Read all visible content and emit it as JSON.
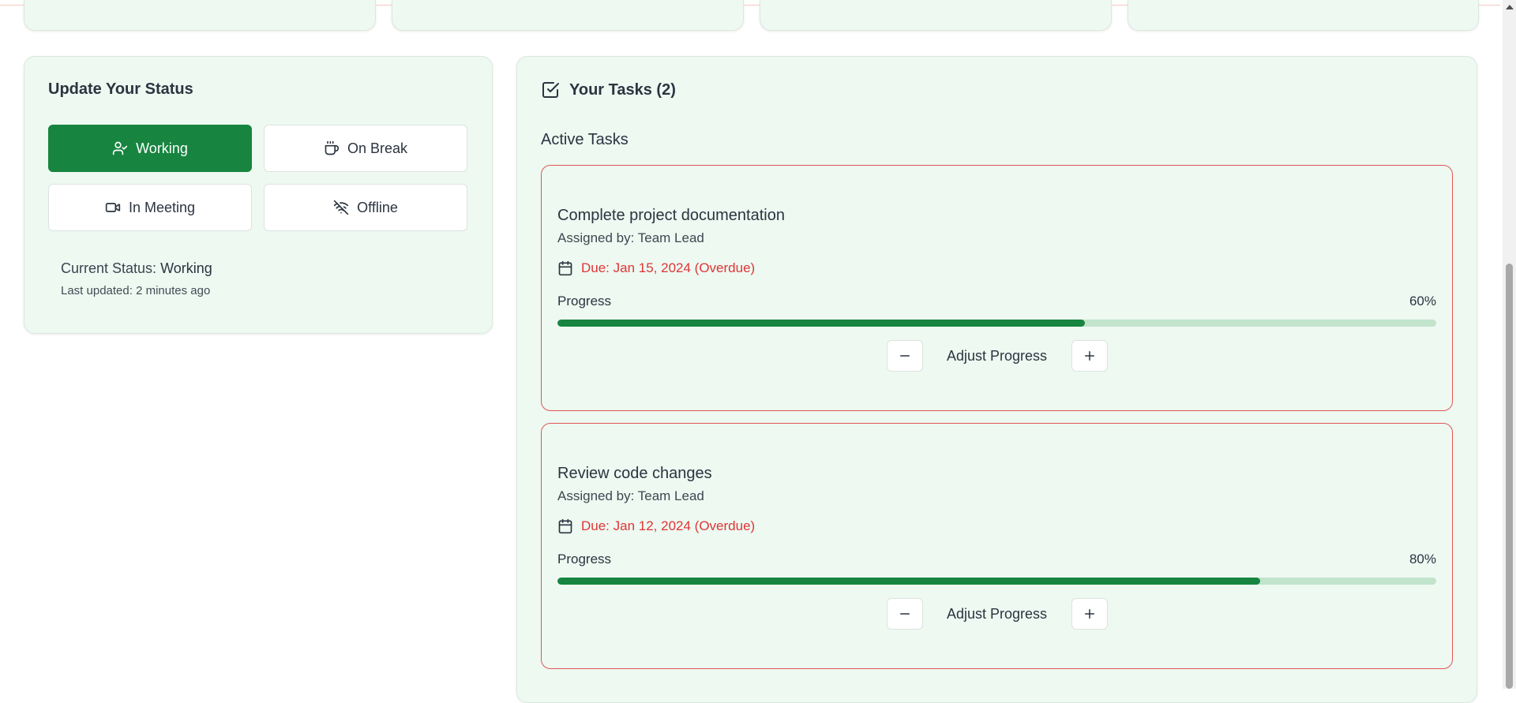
{
  "status": {
    "title": "Update Your Status",
    "buttons": [
      {
        "label": "Working",
        "icon": "user-check-icon",
        "active": true
      },
      {
        "label": "On Break",
        "icon": "coffee-icon",
        "active": false
      },
      {
        "label": "In Meeting",
        "icon": "video-icon",
        "active": false
      },
      {
        "label": "Offline",
        "icon": "wifi-off-icon",
        "active": false
      }
    ],
    "current_label": "Current Status:",
    "current_value": "Working",
    "last_updated": "Last updated: 2 minutes ago"
  },
  "tasks": {
    "title": "Your Tasks (2)",
    "title_icon": "check-square-icon",
    "section_label": "Active Tasks",
    "progress_label": "Progress",
    "adjust_label": "Adjust Progress",
    "items": [
      {
        "title": "Complete project documentation",
        "assigned": "Assigned by: Team Lead",
        "due": "Due: Jan 15, 2024 (Overdue)",
        "progress": 60,
        "progress_text": "60%"
      },
      {
        "title": "Review code changes",
        "assigned": "Assigned by: Team Lead",
        "due": "Due: Jan 12, 2024 (Overdue)",
        "progress": 80,
        "progress_text": "80%"
      }
    ]
  },
  "colors": {
    "accent": "#178540",
    "card_bg": "#edf9f1",
    "overdue": "#e03535",
    "track": "#c2e3cc"
  }
}
